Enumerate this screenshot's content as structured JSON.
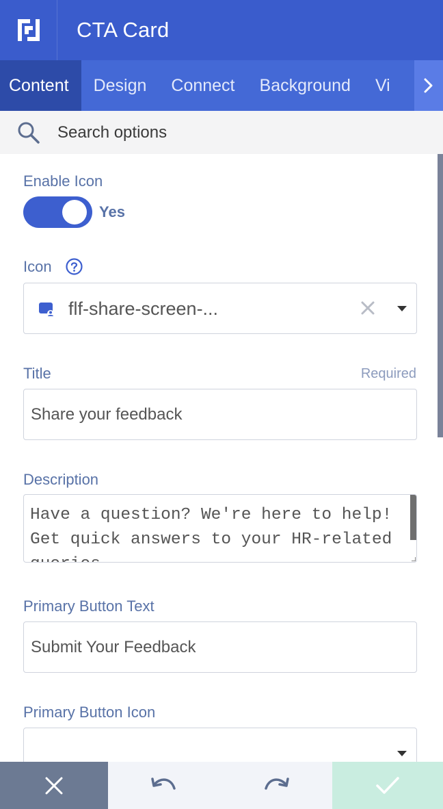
{
  "header": {
    "title": "CTA Card"
  },
  "tabs": [
    {
      "label": "Content",
      "active": true
    },
    {
      "label": "Design"
    },
    {
      "label": "Connect"
    },
    {
      "label": "Background"
    },
    {
      "label": "Visibility"
    }
  ],
  "search": {
    "placeholder": "Search options"
  },
  "form": {
    "enable_icon": {
      "label": "Enable Icon",
      "value": "Yes",
      "on": true
    },
    "icon": {
      "label": "Icon",
      "value": "flf-share-screen-..."
    },
    "title": {
      "label": "Title",
      "required": "Required",
      "value": "Share your feedback"
    },
    "description": {
      "label": "Description",
      "value": "Have a question? We're here to help!\nGet quick answers to your HR-related\nqueries."
    },
    "primary_button_text": {
      "label": "Primary Button Text",
      "value": "Submit Your Feedback"
    },
    "primary_button_icon": {
      "label": "Primary Button Icon",
      "value": ""
    }
  },
  "footer": {
    "cancel": "x-icon",
    "undo": "undo-icon",
    "redo": "redo-icon",
    "save": "check-icon"
  },
  "colors": {
    "header": "#3a5ccc",
    "tabs": "#4469d6",
    "active_tab": "#2d4ba8",
    "accent": "#3d5fcf",
    "label": "#5872a7"
  }
}
